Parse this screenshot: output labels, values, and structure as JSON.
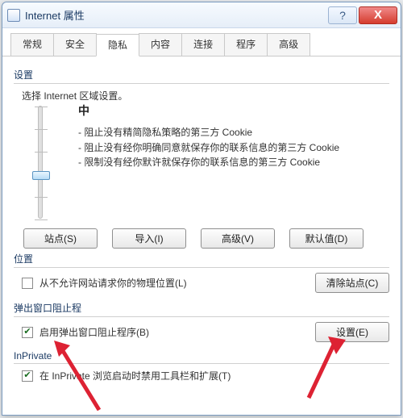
{
  "window": {
    "title": "Internet 属性"
  },
  "titlebar": {
    "help": "?",
    "close": "X"
  },
  "tabs": [
    "常规",
    "安全",
    "隐私",
    "内容",
    "连接",
    "程序",
    "高级"
  ],
  "active_tab_index": 2,
  "settings": {
    "label": "设置",
    "zone_prompt": "选择 Internet 区域设置。",
    "level": "中",
    "bullets": [
      "阻止没有精简隐私策略的第三方 Cookie",
      "阻止没有经你明确同意就保存你的联系信息的第三方 Cookie",
      "限制没有经你默许就保存你的联系信息的第三方 Cookie"
    ],
    "buttons": {
      "sites": "站点(S)",
      "import": "导入(I)",
      "advanced": "高级(V)",
      "default": "默认值(D)"
    }
  },
  "location": {
    "label": "位置",
    "checkbox": "从不允许网站请求你的物理位置(L)",
    "clear": "清除站点(C)"
  },
  "popup": {
    "label": "弹出窗口阻止程",
    "checkbox": "启用弹出窗口阻止程序(B)",
    "settings_btn": "设置(E)"
  },
  "inprivate": {
    "label": "InPrivate",
    "checkbox": "在 InPrivate 浏览启动时禁用工具栏和扩展(T)"
  }
}
